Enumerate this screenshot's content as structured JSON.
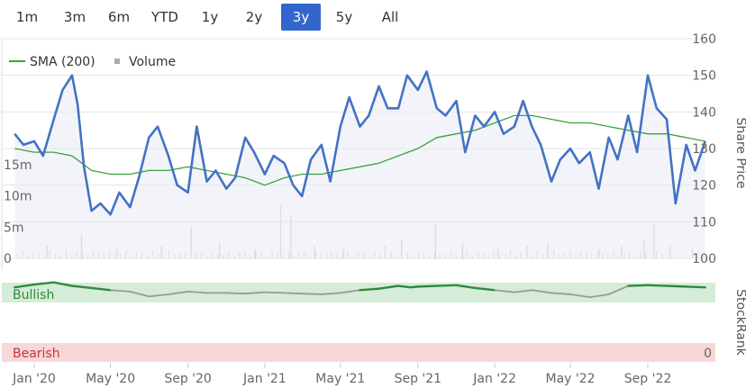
{
  "range_selector": {
    "buttons": [
      "1m",
      "3m",
      "6m",
      "YTD",
      "1y",
      "2y",
      "3y",
      "5y",
      "All"
    ],
    "selected": "3y"
  },
  "colors": {
    "price": "#4472c4",
    "sma": "#3aa33a",
    "volume": "#c8c8c8",
    "rank_line": "#2e8b3e",
    "rank_neutral": "#999999",
    "bullish_band": "#d5ecd8",
    "bearish_band": "#f7d7d7"
  },
  "chart_data": [
    {
      "type": "line",
      "legend": [
        {
          "name": "SMA (200)",
          "icon": "line"
        },
        {
          "name": "Volume",
          "icon": "square"
        }
      ],
      "ylabel": "Share Price",
      "yticks": [
        100,
        110,
        120,
        130,
        140,
        150,
        160
      ],
      "ylim": [
        100,
        160
      ],
      "volume_ticks": [
        "0",
        "5m",
        "10m",
        "15m"
      ],
      "volume_ylim": [
        0,
        30
      ],
      "xticks": [
        "Jan '20",
        "May '20",
        "Sep '20",
        "Jan '21",
        "May '21",
        "Sep '21",
        "Jan '22",
        "May '22",
        "Sep '22"
      ],
      "series": [
        {
          "name": "Share Price",
          "x": [
            "2019-12-01",
            "2019-12-15",
            "2020-01-01",
            "2020-01-15",
            "2020-02-01",
            "2020-02-15",
            "2020-03-01",
            "2020-03-10",
            "2020-03-20",
            "2020-04-01",
            "2020-04-15",
            "2020-05-01",
            "2020-05-15",
            "2020-06-01",
            "2020-06-15",
            "2020-07-01",
            "2020-07-15",
            "2020-08-01",
            "2020-08-15",
            "2020-09-01",
            "2020-09-15",
            "2020-10-01",
            "2020-10-15",
            "2020-11-01",
            "2020-11-15",
            "2020-12-01",
            "2020-12-15",
            "2021-01-01",
            "2021-01-15",
            "2021-02-01",
            "2021-02-15",
            "2021-03-01",
            "2021-03-15",
            "2021-04-01",
            "2021-04-15",
            "2021-05-01",
            "2021-05-15",
            "2021-06-01",
            "2021-06-15",
            "2021-07-01",
            "2021-07-15",
            "2021-08-01",
            "2021-08-15",
            "2021-09-01",
            "2021-09-15",
            "2021-10-01",
            "2021-10-15",
            "2021-11-01",
            "2021-11-15",
            "2021-12-01",
            "2021-12-15",
            "2022-01-01",
            "2022-01-15",
            "2022-02-01",
            "2022-02-15",
            "2022-03-01",
            "2022-03-15",
            "2022-04-01",
            "2022-04-15",
            "2022-05-01",
            "2022-05-15",
            "2022-06-01",
            "2022-06-15",
            "2022-07-01",
            "2022-07-15",
            "2022-08-01",
            "2022-08-15",
            "2022-09-01",
            "2022-09-15",
            "2022-10-01",
            "2022-10-15",
            "2022-11-01",
            "2022-11-15",
            "2022-12-01"
          ],
          "values": [
            134,
            131,
            132,
            128,
            138,
            146,
            150,
            142,
            125,
            113,
            115,
            112,
            118,
            114,
            122,
            133,
            136,
            128,
            120,
            118,
            136,
            121,
            124,
            119,
            122,
            133,
            129,
            123,
            128,
            126,
            120,
            117,
            127,
            131,
            121,
            136,
            144,
            136,
            139,
            147,
            141,
            141,
            150,
            146,
            151,
            141,
            139,
            143,
            129,
            139,
            136,
            140,
            134,
            136,
            143,
            136,
            131,
            121,
            127,
            130,
            126,
            129,
            119,
            133,
            127,
            139,
            129,
            150,
            141,
            138,
            115,
            131,
            124,
            132
          ]
        },
        {
          "name": "SMA (200)",
          "x": [
            "2019-12-01",
            "2020-01-01",
            "2020-02-01",
            "2020-03-01",
            "2020-04-01",
            "2020-05-01",
            "2020-06-01",
            "2020-07-01",
            "2020-08-01",
            "2020-09-01",
            "2020-10-01",
            "2020-11-01",
            "2020-12-01",
            "2021-01-01",
            "2021-02-01",
            "2021-03-01",
            "2021-04-01",
            "2021-05-01",
            "2021-06-01",
            "2021-07-01",
            "2021-08-01",
            "2021-09-01",
            "2021-10-01",
            "2021-11-01",
            "2021-12-01",
            "2022-01-01",
            "2022-02-01",
            "2022-03-01",
            "2022-04-01",
            "2022-05-01",
            "2022-06-01",
            "2022-07-01",
            "2022-08-01",
            "2022-09-01",
            "2022-10-01",
            "2022-11-01",
            "2022-12-01"
          ],
          "values": [
            130,
            129,
            129,
            128,
            124,
            123,
            123,
            124,
            124,
            125,
            124,
            123,
            122,
            120,
            122,
            123,
            123,
            124,
            125,
            126,
            128,
            130,
            133,
            134,
            135,
            137,
            139,
            139,
            138,
            137,
            137,
            136,
            135,
            134,
            134,
            133,
            132
          ]
        }
      ]
    },
    {
      "type": "line",
      "title": "StockRank",
      "zones": [
        {
          "name": "Bullish",
          "band": [
            70,
            100
          ]
        },
        {
          "name": "Bearish",
          "band": [
            0,
            10
          ]
        }
      ],
      "ytick": "0",
      "ylim": [
        0,
        100
      ],
      "series": [
        {
          "name": "StockRank",
          "x": [
            "2019-12-01",
            "2020-01-01",
            "2020-02-01",
            "2020-03-01",
            "2020-04-01",
            "2020-05-01",
            "2020-06-01",
            "2020-07-01",
            "2020-08-01",
            "2020-09-01",
            "2020-10-01",
            "2020-11-01",
            "2020-12-01",
            "2021-01-01",
            "2021-02-01",
            "2021-03-01",
            "2021-04-01",
            "2021-05-01",
            "2021-06-01",
            "2021-07-01",
            "2021-08-01",
            "2021-08-20",
            "2021-09-01",
            "2021-10-01",
            "2021-11-01",
            "2021-12-01",
            "2022-01-01",
            "2022-02-01",
            "2022-03-01",
            "2022-04-01",
            "2022-05-01",
            "2022-06-01",
            "2022-07-01",
            "2022-08-01",
            "2022-09-01",
            "2022-10-01",
            "2022-11-01",
            "2022-12-01"
          ],
          "values": [
            78,
            82,
            85,
            80,
            77,
            74,
            72,
            65,
            68,
            72,
            70,
            70,
            69,
            71,
            70,
            69,
            68,
            70,
            74,
            76,
            80,
            78,
            79,
            80,
            81,
            77,
            74,
            71,
            74,
            70,
            68,
            64,
            68,
            80,
            81,
            80,
            79,
            78
          ]
        }
      ]
    }
  ]
}
